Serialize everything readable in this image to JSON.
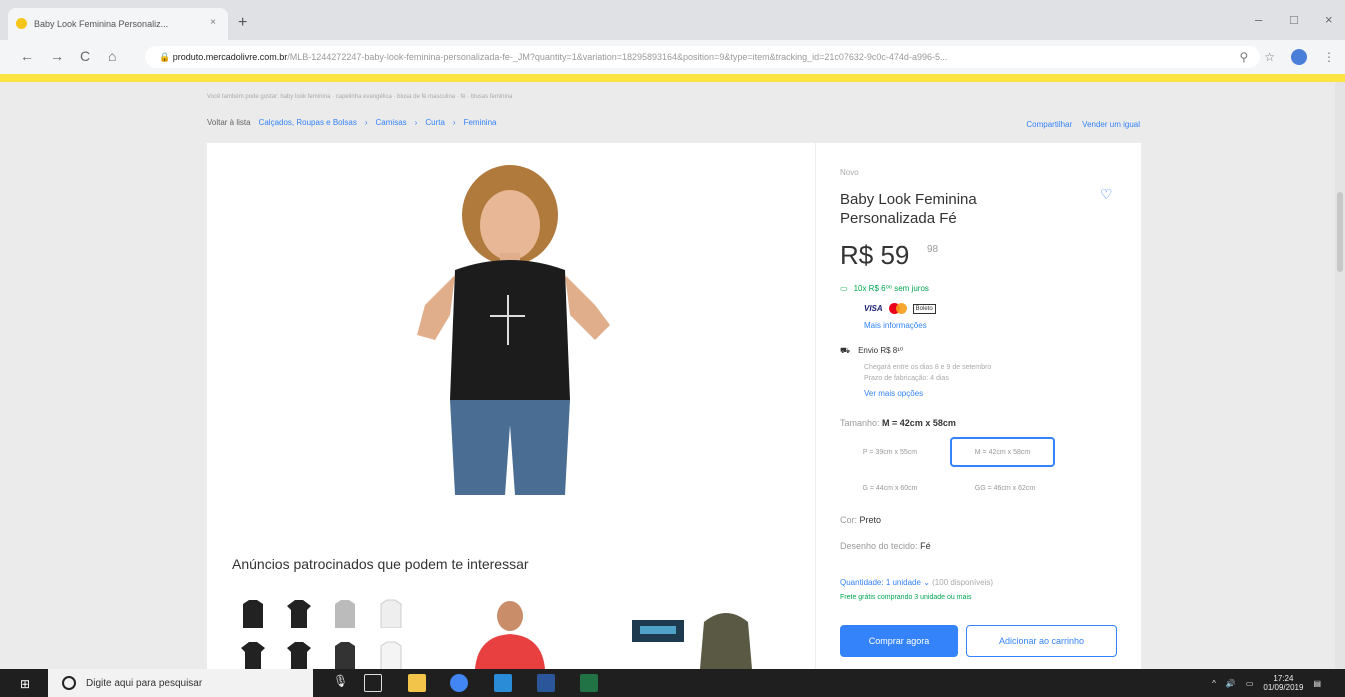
{
  "browser": {
    "tab_title": "Baby Look Feminina Personaliz...",
    "tab_close": "×",
    "new_tab": "+",
    "win_min": "–",
    "win_max": "□",
    "win_close": "×",
    "url_host": "produto.mercadolivre.com.br",
    "url_path": "/MLB-1244272247-baby-look-feminina-personalizada-fe-_JM?quantity=1&variation=18295893164&position=9&type=item&tracking_id=21c07632-9c0c-474d-a996-5...",
    "nav_back": "←",
    "nav_forward": "→",
    "nav_reload": "C",
    "nav_home": "⌂"
  },
  "page": {
    "breadcrumb_top": "Você também pode gostar: baby look feminina · capelinha evangélica · blusa de fé masculina · fé · blusas feminina",
    "back_label": "Voltar à lista",
    "crumbs": [
      "Calçados, Roupas e Bolsas",
      "Camisas",
      "Curta",
      "Feminina"
    ],
    "crumb_sep": "›",
    "share_label": "Compartilhar",
    "sell_label": "Vender um igual"
  },
  "product": {
    "condition": "Novo",
    "title": "Baby Look Feminina Personalizada Fé",
    "price_main": "R$ 59",
    "price_cents": "98",
    "installment": "10x R$ 6⁰⁰ sem juros",
    "card_visa": "VISA",
    "card_boleto": "Boleto",
    "more_info": "Mais informações",
    "shipping": "Envio R$ 8¹⁰",
    "shipping_detail_1": "Chegará entre os dias 8 e 9 de setembro",
    "shipping_detail_2": "Prazo de fabricação: 4 dias",
    "shipping_more": "Ver mais opções",
    "size_label": "Tamanho:",
    "size_selected": "M = 42cm x 58cm",
    "sizes": [
      "P = 39cm x 55cm",
      "M = 42cm x 58cm",
      "G = 44cm x 60cm",
      "GG = 46cm x 62cm"
    ],
    "color_label": "Cor:",
    "color_value": "Preto",
    "fabric_label": "Desenho do tecido:",
    "fabric_value": "Fé",
    "qty_label": "Quantidade: 1 unidade",
    "qty_avail": "(100 disponíveis)",
    "free_shipping": "Frete grátis comprando 3 unidade ou mais",
    "buy_now": "Comprar agora",
    "add_cart": "Adicionar ao carrinho",
    "fav_icon": "heart-icon"
  },
  "sponsored": {
    "heading": "Anúncios patrocinados que podem te interessar"
  },
  "taskbar": {
    "search_placeholder": "Digite aqui para pesquisar",
    "time": "17:24",
    "date": "01/09/2019"
  },
  "colors": {
    "ml_yellow": "#fde442",
    "link_blue": "#3483fa",
    "green": "#00a650"
  }
}
